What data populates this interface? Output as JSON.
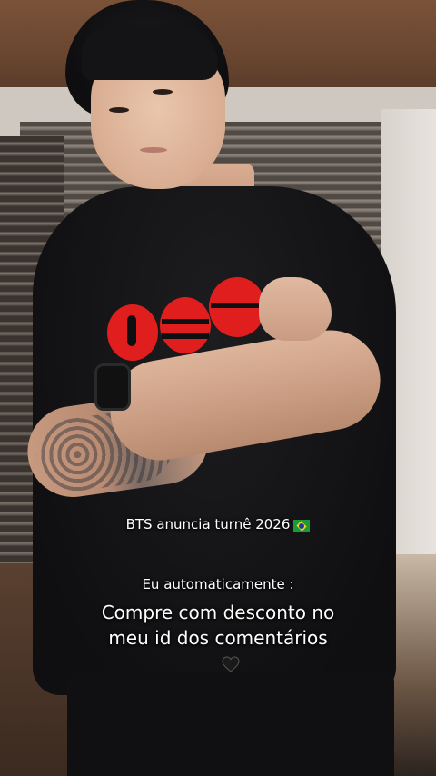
{
  "captions": {
    "line1": "BTS anuncia turnê 2026",
    "line1_flag": "brazil-flag-emoji",
    "line2": "Eu automaticamente :",
    "line3a": "Compre com desconto no",
    "line3b": "meu id dos comentários",
    "heart": "black-heart-emoji"
  },
  "colors": {
    "shirt": "#0f0f11",
    "logo_red": "#e01e1e",
    "caption_text": "#ffffff"
  }
}
